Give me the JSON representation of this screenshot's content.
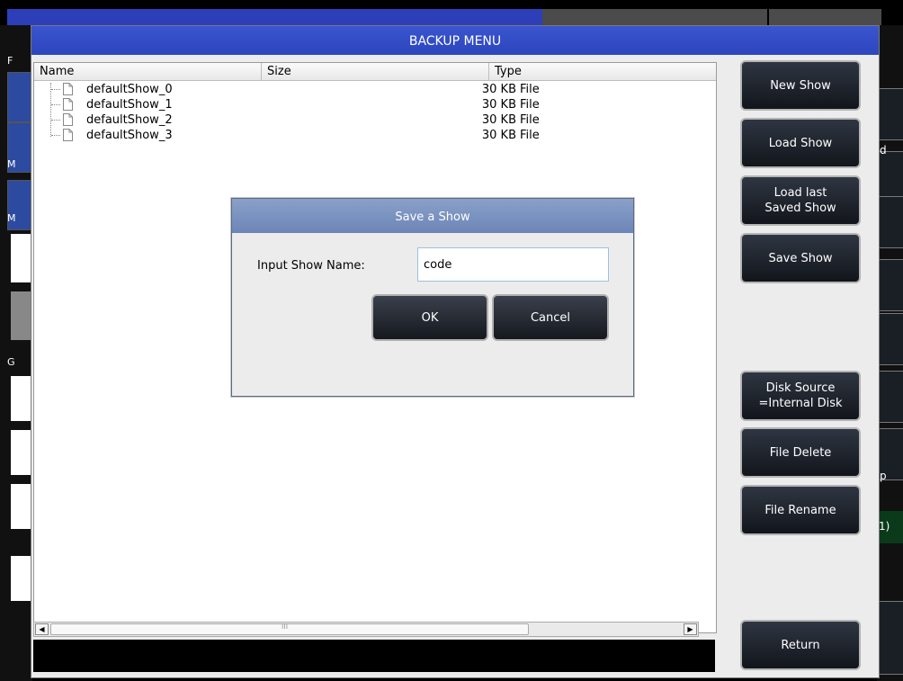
{
  "window": {
    "title": "BACKUP MENU"
  },
  "file_list": {
    "columns": [
      "Name",
      "Size",
      "Type"
    ],
    "rows": [
      {
        "name": "defaultShow_0",
        "size": "30 KB",
        "type": "File"
      },
      {
        "name": "defaultShow_1",
        "size": "30 KB",
        "type": "File"
      },
      {
        "name": "defaultShow_2",
        "size": "30 KB",
        "type": "File"
      },
      {
        "name": "defaultShow_3",
        "size": "30 KB",
        "type": "File"
      }
    ]
  },
  "buttons": {
    "new_show": "New Show",
    "load_show": "Load Show",
    "load_last_saved_show": "Load last\nSaved Show",
    "save_show": "Save Show",
    "disk_source": "Disk Source\n=Internal Disk",
    "file_delete": "File Delete",
    "file_rename": "File Rename",
    "return": "Return"
  },
  "dialog": {
    "title": "Save a Show",
    "label": "Input Show Name:",
    "input_value": "code",
    "ok": "OK",
    "cancel": "Cancel"
  },
  "background": {
    "left_labels": [
      "F",
      "M",
      "M",
      "G"
    ],
    "right_labels": [
      "d",
      "p",
      "1)"
    ]
  },
  "scrollbar": {
    "grip": "III"
  }
}
